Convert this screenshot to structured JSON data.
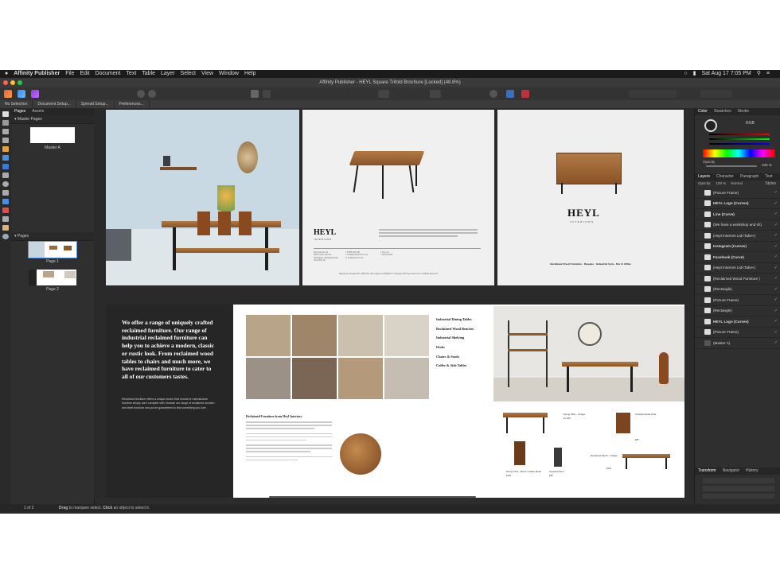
{
  "menubar": {
    "app_name": "Affinity Publisher",
    "items": [
      "File",
      "Edit",
      "Document",
      "Text",
      "Table",
      "Layer",
      "Select",
      "View",
      "Window",
      "Help"
    ],
    "clock": "Sat Aug 17  7:05 PM"
  },
  "titlebar": {
    "title": "Affinity Publisher - HEYL Square Trifold Brochure [Locked] (48.8%)"
  },
  "context_bar": {
    "no_selection": "No Selection",
    "document_setup": "Document Setup...",
    "spread_setup": "Spread Setup...",
    "preferences": "Preferences..."
  },
  "left_panel": {
    "tabs": [
      "Pages",
      "Assets"
    ],
    "master_section": "Master Pages",
    "master_label": "Master A",
    "pages_section": "Pages",
    "page_labels": [
      "Page 1",
      "Page 2"
    ]
  },
  "right_panel": {
    "color_tabs": [
      "Color",
      "Swatches",
      "Stroke"
    ],
    "color_mode": "RGB",
    "opacity_label": "Opacity",
    "opacity_value": "100 %",
    "layer_tabs": [
      "Layers",
      "Character",
      "Paragraph",
      "Text Styles"
    ],
    "layer_opacity_label": "Opacity:",
    "layer_opacity_value": "100 %",
    "blend_mode": "Normal",
    "layers": [
      "(Picture Frame)",
      "HEYL Logo (Curves)",
      "Line (Curve)",
      "(We have a workshop and sh)",
      "(Heyl Interiors Ltd<Tabe<)",
      "Instagram (Curves)",
      "Facebook (Curve)",
      "(Heyl Interiors Ltd<Tabe<)",
      "(Reclaimed Wood Furniture )",
      "(Rectangle)",
      "(Picture Frame)",
      "(Rectangle)",
      "HEYL Logo (Curves)",
      "(Picture Frame)",
      "(Master A)"
    ],
    "transform_tabs": [
      "Transform",
      "Navigator",
      "History"
    ]
  },
  "status": {
    "pages": "1 of 2",
    "hint_bold1": "Drag",
    "hint_1": "to marquee select.",
    "hint_bold2": "Click",
    "hint_2": "an object to select it."
  },
  "spread1": {
    "logo": "HEYL",
    "logo_sub": "INTERIORS",
    "tagline": "Reclaimed Wood Furniture - Bespoke - Industrial Style - Bar & Office",
    "address_lines": [
      "Heyl Interiors Ltd",
      "Manor Farm, Barn B,",
      "Nottingham, Nottinghamshire",
      "NG11 6NL UK"
    ],
    "contact_lines": [
      "t: 07535 421 000",
      "e: info@heylinteriors.co.uk",
      "w: heylinteriors.co.uk"
    ],
    "social_lines": [
      "f: heyl_int",
      "f: heyl interiors"
    ],
    "registered": "Registered in England No. 09876736. VAT registered 237899414 © Copyright 2019 Heyl Interiors Ltd. All Rights Reserved"
  },
  "spread2": {
    "headline": "We offer a range of uniquely crafted reclaimed furniture. Our range of industrial reclaimed furniture can help you to achieve a modern, classic or rustic look. From reclaimed wood tables to chairs and much more, we have reclaimed furniture to cater to all of our customers tastes.",
    "body": "Reclaimed furniture offers a unique charm that normal or manufacture furniture simply can't compete with. Browse our range of reclaimed wooden and steel furniture and you're guaranteed to find something you love.",
    "categories": [
      "Industrial Dining Tables",
      "Reclaimed Wood Benches",
      "Industrial Shelving",
      "Desks",
      "Chairs & Stools",
      "Coffee & Side Tables"
    ],
    "article_title": "Reclaimed Furniture from Heyl Interiors",
    "product_labels": [
      "Dining Table - Vintage",
      "Industrial Metal Chair",
      "Dining Chair - Brown Leather Metal",
      "Industrial Stool",
      "Reclaimed Bench - Vintage"
    ],
    "product_prices": [
      "£1,250",
      "£85",
      "£120",
      "£95",
      "£410"
    ]
  }
}
